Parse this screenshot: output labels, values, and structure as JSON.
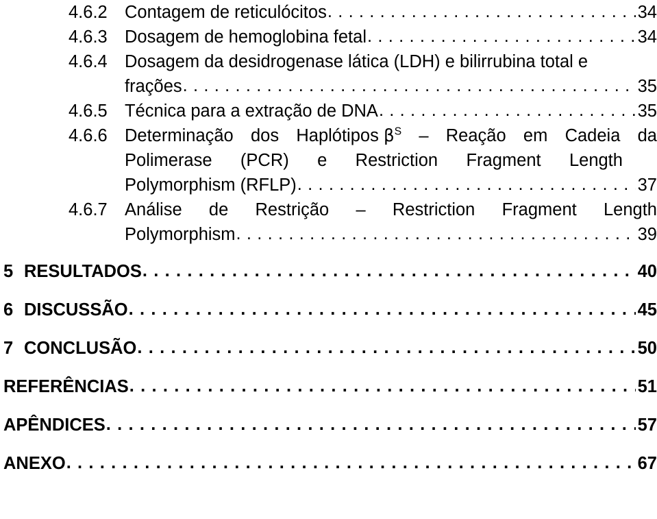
{
  "document": {
    "type": "table-of-contents",
    "language": "pt-BR"
  },
  "entries": [
    {
      "id": "4-6-2",
      "number": "4.6.2",
      "label": "Contagem de reticulócitos",
      "page": "34",
      "level": 3,
      "bold": false
    },
    {
      "id": "4-6-3",
      "number": "4.6.3",
      "label": "Dosagem de hemoglobina fetal ",
      "page": "34",
      "level": 3,
      "bold": false
    },
    {
      "id": "4-6-4",
      "number": "4.6.4",
      "label": "Dosagem da desidrogenase lática (LDH) e bilirrubina total e",
      "continuation": "frações",
      "page": "35",
      "level": 3,
      "bold": false
    },
    {
      "id": "4-6-5",
      "number": "4.6.5",
      "label": "Técnica para a extração de DNA",
      "page": "35",
      "level": 3,
      "bold": false
    },
    {
      "id": "4-6-6",
      "number": "4.6.6",
      "label_words": [
        "Determinação",
        "dos",
        "Haplótipos"
      ],
      "symbol_beta": "β",
      "symbol_superscript": "S",
      "label_words_after": [
        "–",
        "Reação",
        "em",
        "Cadeia",
        "da"
      ],
      "continuation_words": [
        "Polimerase",
        "(PCR)",
        "e",
        "Restriction",
        "Fragment",
        "Length"
      ],
      "continuation2": "Polymorphism (RFLP)",
      "page": "37",
      "level": 3,
      "bold": false
    },
    {
      "id": "4-6-7",
      "number": "4.6.7",
      "label_words": [
        "Análise",
        "de",
        "Restrição",
        "–",
        "Restriction",
        "Fragment",
        "Length"
      ],
      "continuation": "Polymorphism",
      "page": "39",
      "level": 3,
      "bold": false
    },
    {
      "id": "5-resultados",
      "number": "5",
      "label": "RESULTADOS",
      "page": "40",
      "level": 1,
      "bold": true
    },
    {
      "id": "6-discussao",
      "number": "6",
      "label": "DISCUSSÃO",
      "page": "45",
      "level": 1,
      "bold": true
    },
    {
      "id": "7-conclusao",
      "number": "7",
      "label": "CONCLUSÃO",
      "page": "50",
      "level": 1,
      "bold": true
    },
    {
      "id": "referencias",
      "number": "",
      "label": "REFERÊNCIAS",
      "page": "51",
      "level": 1,
      "bold": true
    },
    {
      "id": "apendices",
      "number": "",
      "label": "APÊNDICES ",
      "page": "57",
      "level": 1,
      "bold": true
    },
    {
      "id": "anexo",
      "number": "",
      "label": "ANEXO",
      "page": "67",
      "level": 1,
      "bold": true
    }
  ]
}
